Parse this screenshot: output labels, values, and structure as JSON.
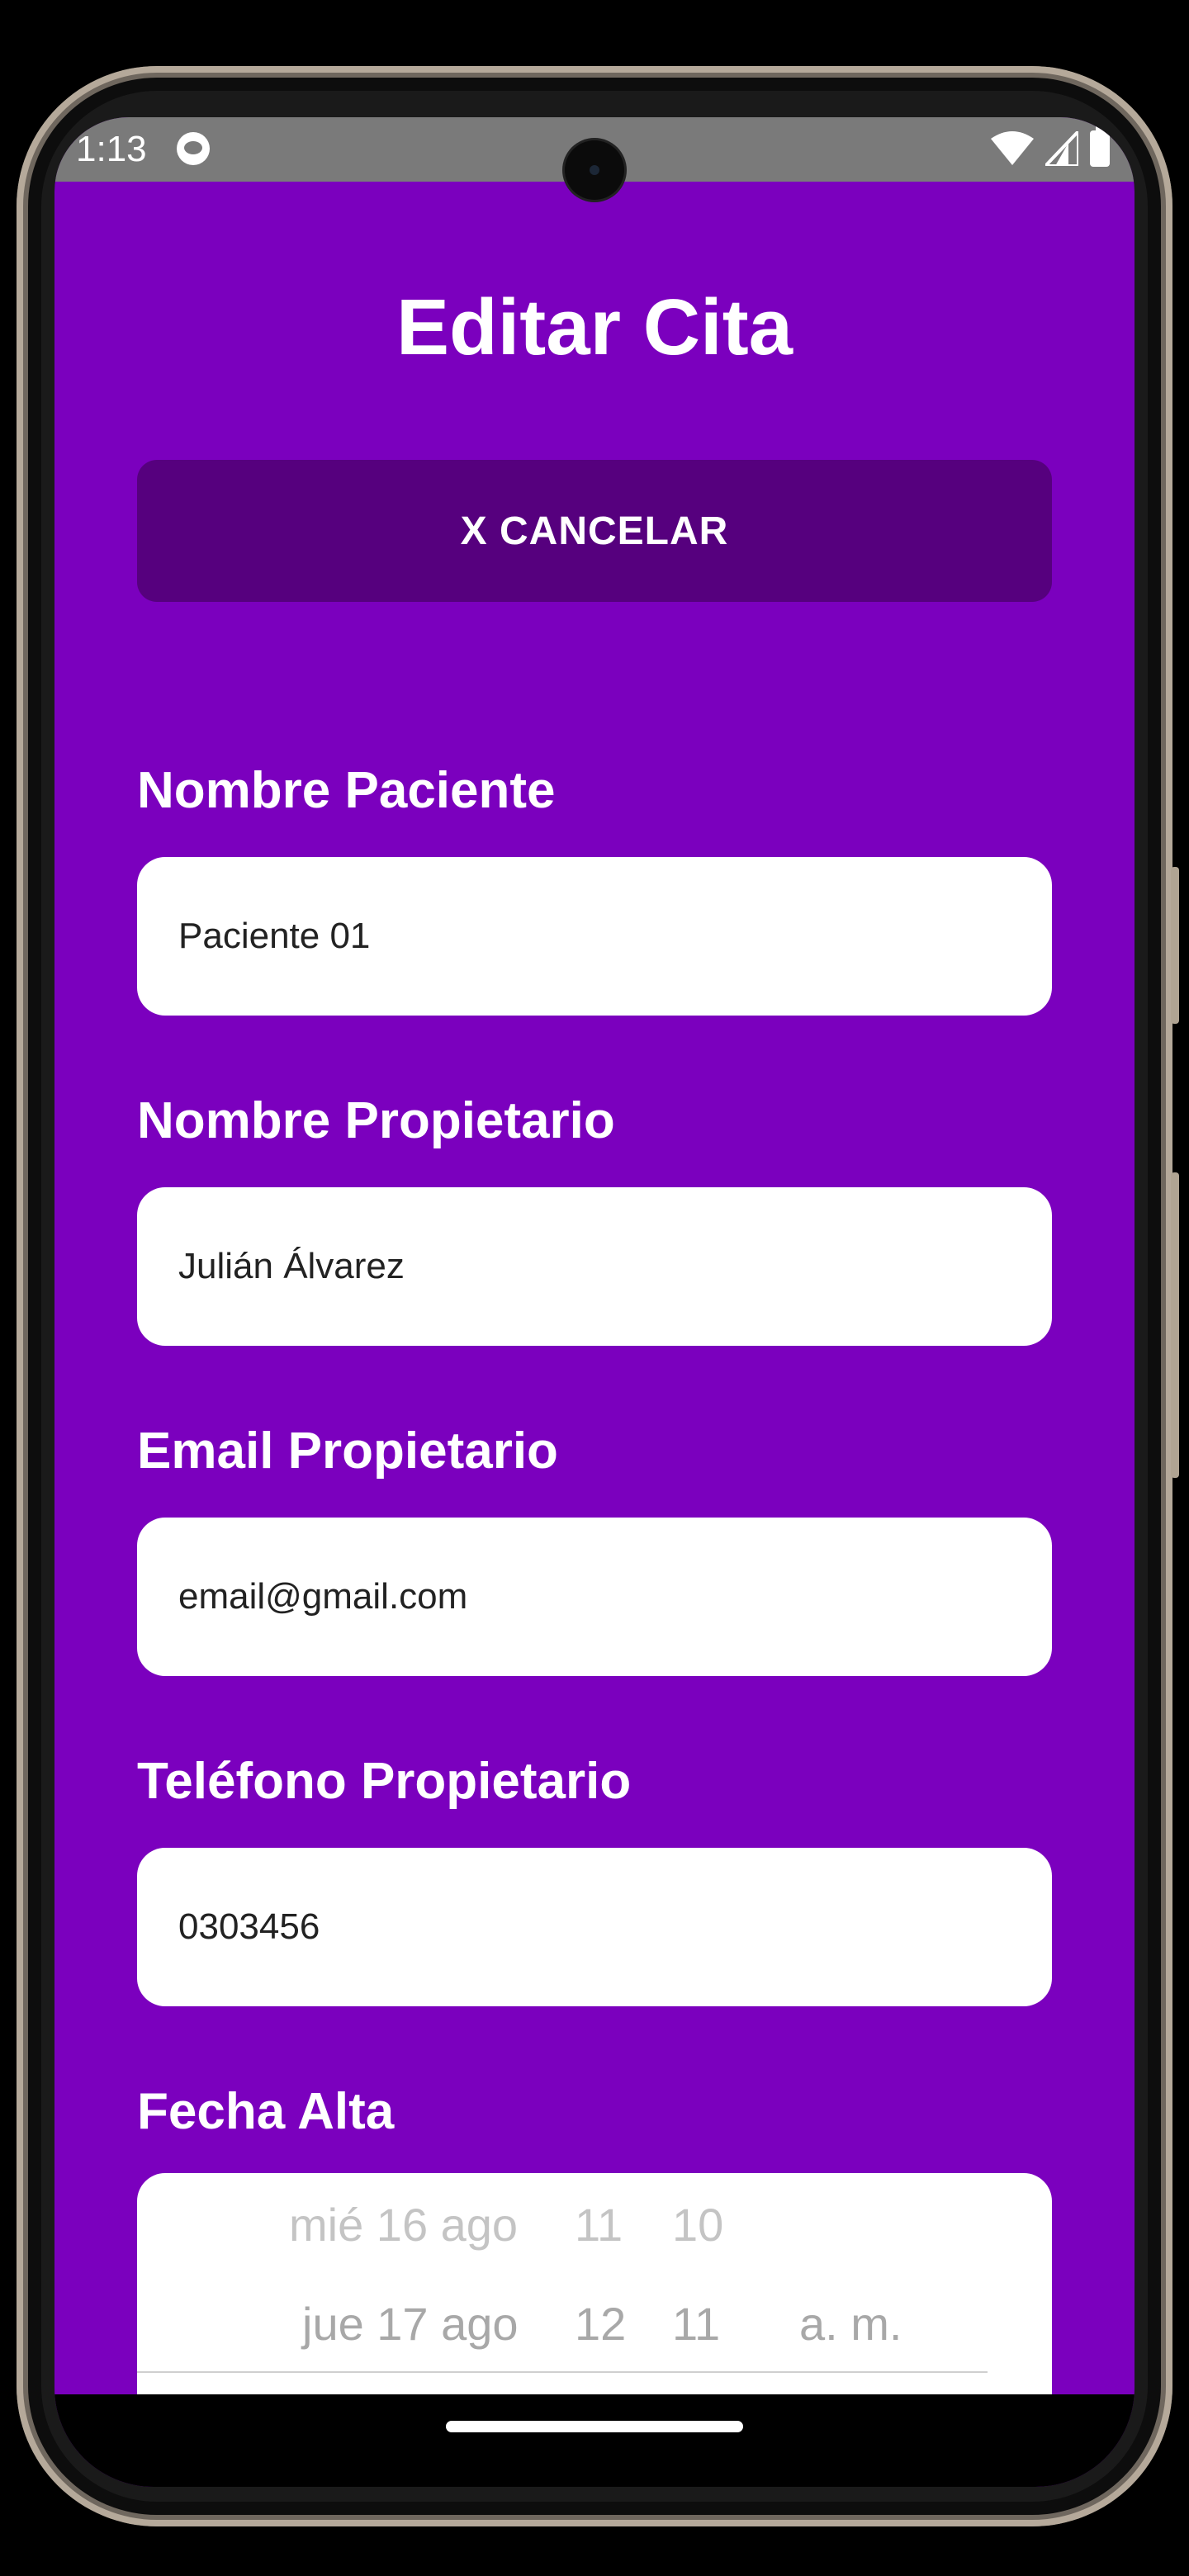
{
  "status_bar": {
    "time": "1:13"
  },
  "header": {
    "title": "Editar Cita"
  },
  "actions": {
    "cancel_label": "X CANCELAR"
  },
  "form": {
    "fields": [
      {
        "label": "Nombre Paciente",
        "value": "Paciente 01"
      },
      {
        "label": "Nombre Propietario",
        "value": "Julián Álvarez"
      },
      {
        "label": "Email Propietario",
        "value": "email@gmail.com"
      },
      {
        "label": "Teléfono Propietario",
        "value": "0303456"
      }
    ],
    "date_label": "Fecha Alta",
    "date_picker": {
      "previous": {
        "date": "mié 16 ago",
        "hour": "11",
        "minute": "10"
      },
      "current": {
        "date": "jue 17 ago",
        "hour": "12",
        "minute": "11",
        "period": "a. m."
      }
    }
  },
  "colors": {
    "background": "#7b00be",
    "cancel_button": "#56007e",
    "field_background": "#ffffff"
  }
}
